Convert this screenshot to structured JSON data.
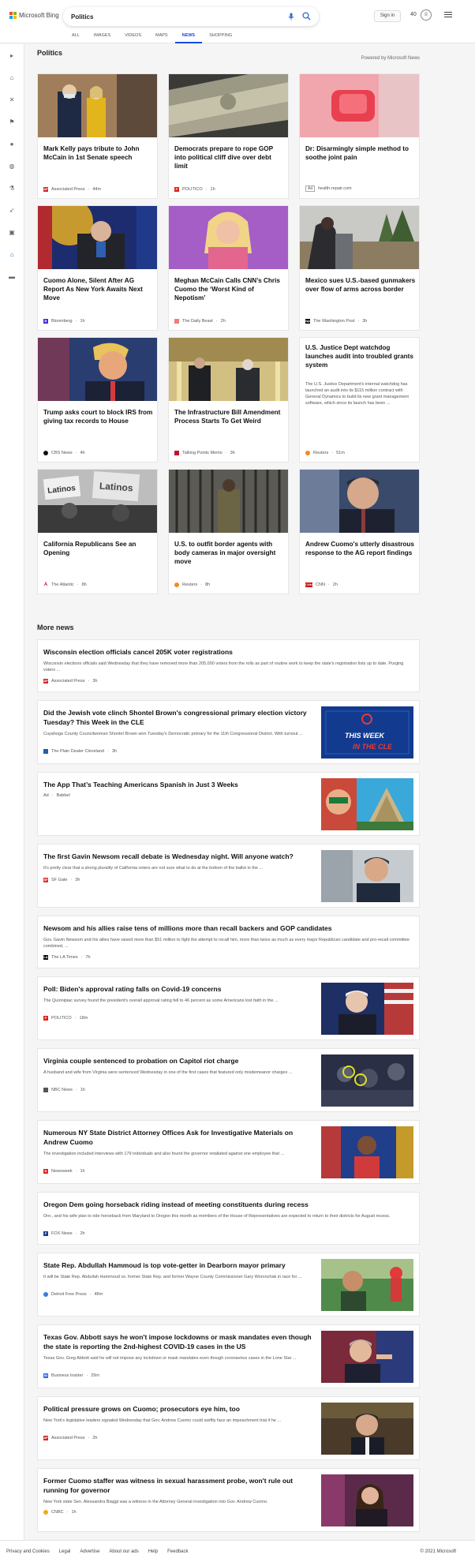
{
  "header": {
    "logo_text": "Microsoft Bing",
    "search_value": "Politics",
    "sign_in": "Sign in",
    "points": "40",
    "tabs": [
      "ALL",
      "IMAGES",
      "VIDEOS",
      "MAPS",
      "NEWS",
      "SHOPPING"
    ],
    "active_tab": "NEWS"
  },
  "section": {
    "title": "Politics",
    "powered": "Powered by Microsoft News"
  },
  "cards": [
    {
      "title": "Mark Kelly pays tribute to John McCain in 1st Senate speech",
      "source": "Associated Press",
      "time": "44m",
      "icon_color": "#d9262e",
      "icon_label": "AP"
    },
    {
      "title": "Democrats prepare to rope GOP into political cliff dive over debt limit",
      "source": "POLITICO",
      "time": "1h",
      "icon_color": "#e2231a",
      "icon_label": "P"
    },
    {
      "title": "Dr: Disarmingly simple method to soothe joint pain",
      "source": "health-repair.com",
      "time": "",
      "icon_color": "#ffffff",
      "icon_label": "Ad"
    },
    {
      "title": "Cuomo Alone, Silent After AG Report As New York Awaits Next Move",
      "source": "Bloomberg",
      "time": "1h",
      "icon_color": "#472ee0",
      "icon_label": "B"
    },
    {
      "title": "Meghan McCain Calls CNN’s Chris Cuomo the ‘Worst Kind of Nepotism’",
      "source": "The Daily Beast",
      "time": "2h",
      "icon_color": "#ef7b7b",
      "icon_label": ""
    },
    {
      "title": "Mexico sues U.S.-based gunmakers over flow of arms across border",
      "source": "The Washington Post",
      "time": "3h",
      "icon_color": "#111111",
      "icon_label": "wp"
    },
    {
      "title": "Trump asks court to block IRS from giving tax records to House",
      "source": "CBS News",
      "time": "4h",
      "icon_color": "#111111",
      "icon_label": "●"
    },
    {
      "title": "The Infrastructure Bill Amendment Process Starts To Get Weird",
      "source": "Talking Points Memo",
      "time": "3h",
      "icon_color": "#c8102e",
      "icon_label": ""
    },
    {
      "title": "U.S. Justice Dept watchdog launches audit into troubled grants system",
      "snippet": "The U.S. Justice Department's internal watchdog has launched an audit into its $115 million contract with General Dynamics to build its new grant management software, which since its launch has been ...",
      "source": "Reuters",
      "time": "51m",
      "icon_color": "#f28b22",
      "icon_label": ""
    },
    {
      "title": "California Republicans See an Opening",
      "source": "The Atlantic",
      "time": "8h",
      "icon_color": "#c8102e",
      "icon_label": "A"
    },
    {
      "title": "U.S. to outfit border agents with body cameras in major oversight move",
      "source": "Reuters",
      "time": "8h",
      "icon_color": "#f28b22",
      "icon_label": ""
    },
    {
      "title": "Andrew Cuomo's utterly disastrous response to the AG report findings",
      "source": "CNN",
      "time": "2h",
      "icon_color": "#cc0000",
      "icon_label": "CNN"
    }
  ],
  "image_texts": {
    "latinos_sign": "Latinos",
    "week_cle_line1": "THIS WEEK",
    "week_cle_line2": "IN THE CLE"
  },
  "more_news": {
    "title": "More news",
    "items": [
      {
        "title": "Wisconsin election officials cancel 205K voter registrations",
        "snippet": "Wisconsin elections officials said Wednesday that they have removed more than 205,000 voters from the rolls as part of routine work to keep the state's registration lists up to date. Purging voters ...",
        "source": "Associated Press",
        "time": "3h",
        "icon_color": "#d9262e",
        "icon_label": "AP"
      },
      {
        "title": "Did the Jewish vote clinch Shontel Brown's congressional primary election victory Tuesday? This Week in the CLE",
        "snippet": "Cuyahoga County Councilwoman Shontel Brown won Tuesday's Democratic primary for the 11th Congressional District. With turnout ...",
        "source": "The Plain Dealer Cleveland",
        "time": "3h",
        "icon_color": "#1f5fa8",
        "icon_label": "PD"
      },
      {
        "title": "The App That’s Teaching Americans Spanish in Just 3 Weeks",
        "snippet": "",
        "source": "Babbel",
        "time": "",
        "ad": "Ad",
        "icon_color": "",
        "icon_label": ""
      },
      {
        "title": "The first Gavin Newsom recall debate is Wednesday night. Will anyone watch?",
        "snippet": "It's pretty clear that a strong plurality of California voters are not sure what to do at the bottom of the ballot in the ...",
        "source": "SF Gate",
        "time": "3h",
        "icon_color": "#e4322b",
        "icon_label": "SF"
      },
      {
        "title": "Newsom and his allies raise tens of millions more than recall backers and GOP candidates",
        "snippet": "Gov. Gavin Newsom and his allies have raised more than $51 million to fight the attempt to recall him, more than twice as much as every major Republican candidate and pro-recall committee combined, ...",
        "source": "The LA Times",
        "time": "7h",
        "icon_color": "#111111",
        "icon_label": "LA"
      },
      {
        "title": "Poll: Biden's approval rating falls on Covid-19 concerns",
        "snippet": "The Quinnipiac survey found the president's overall approval rating fell to 46 percent as some Americans lost faith in the ...",
        "source": "POLITICO",
        "time": "18m",
        "icon_color": "#e2231a",
        "icon_label": "P"
      },
      {
        "title": "Virginia couple sentenced to probation on Capitol riot charge",
        "snippet": "A husband and wife from Virginia were sentenced Wednesday in one of the first cases that featured only misdemeanor charges ...",
        "source": "NBC News",
        "time": "1h",
        "icon_color": "#555555",
        "icon_label": "N"
      },
      {
        "title": "Numerous NY State District Attorney Offices Ask for Investigative Materials on Andrew Cuomo",
        "snippet": "The investigation included interviews with 179 individuals and also found the governor retaliated against one employee that ...",
        "source": "Newsweek",
        "time": "1h",
        "icon_color": "#e2231a",
        "icon_label": "N"
      },
      {
        "title": "Oregon Dem going horseback riding instead of meeting constituents during recess",
        "snippet": "Ore., and his wife plan to ride horseback from Maryland to Oregon this month as members of the House of Representatives are expected to return to their districts for August recess.",
        "source": "FOX News",
        "time": "2h",
        "icon_color": "#1c3f94",
        "icon_label": "F"
      },
      {
        "title": "State Rep. Abdullah Hammoud is top vote-getter in Dearborn mayor primary",
        "snippet": "It will be State Rep. Abdullah Hammoud vs. former State Rep. and former Wayne County Commissioner Gary Woronchak in race for ...",
        "source": "Detroit Free Press",
        "time": "48m",
        "icon_color": "#3a7bd5",
        "icon_label": ""
      },
      {
        "title": "Texas Gov. Abbott says he won't impose lockdowns or mask mandates even though the state is reporting the 2nd-highest COVID-19 cases in the US",
        "snippet": "Texas Gov. Greg Abbott said he will not impose any lockdown or mask mandates even though coronavirus cases in the Lone Star ...",
        "source": "Business Insider",
        "time": "29m",
        "icon_color": "#2a6df4",
        "icon_label": "BI"
      },
      {
        "title": "Political pressure grows on Cuomo; prosecutors eye him, too",
        "snippet": "New York's legislative leaders signaled Wednesday that Gov. Andrew Cuomo could swiftly face an impeachment trial if he ...",
        "source": "Associated Press",
        "time": "2h",
        "icon_color": "#d9262e",
        "icon_label": "AP"
      },
      {
        "title": "Former Cuomo staffer was witness in sexual harassment probe, won't rule out running for governor",
        "snippet": "New York state Sen. Alessandra Biaggi was a witness in the Attorney General investigation into Gov. Andrew Cuomo.",
        "source": "CNBC",
        "time": "1h",
        "icon_color": "#f5a623",
        "icon_label": ""
      }
    ]
  },
  "footer": {
    "links": [
      "Privacy and Cookies",
      "Legal",
      "Advertise",
      "About our ads",
      "Help",
      "Feedback"
    ],
    "copyright": "© 2021 Microsoft"
  }
}
